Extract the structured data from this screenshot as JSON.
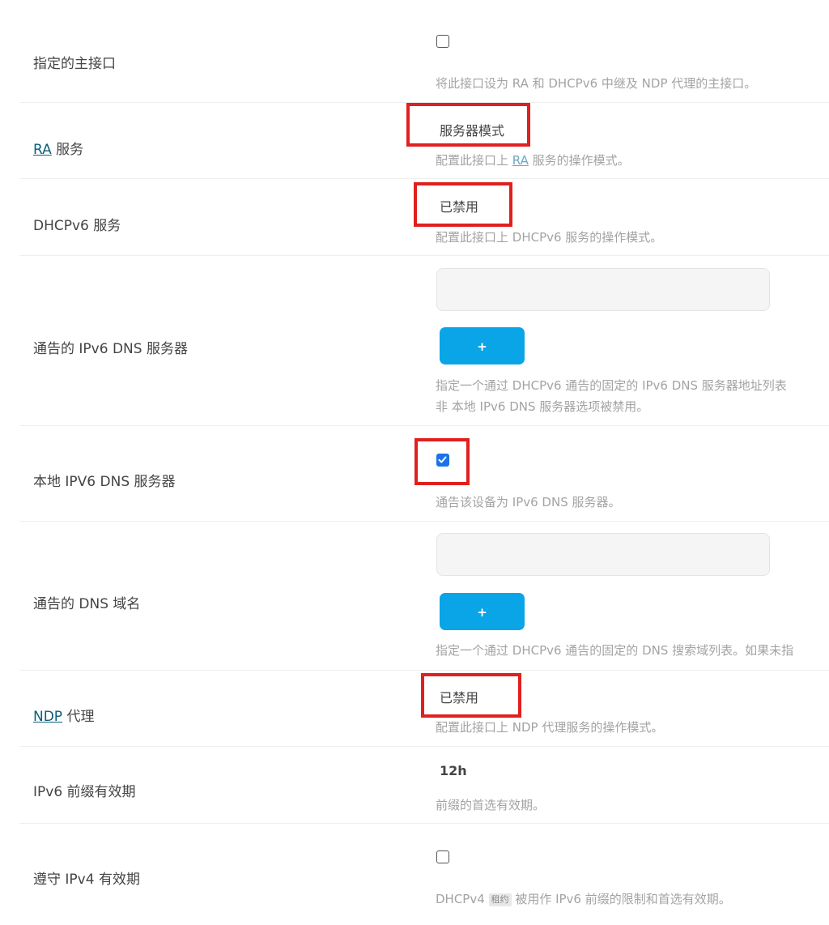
{
  "rows": {
    "master": {
      "label": "指定的主接口",
      "checked": false,
      "desc": "将此接口设为 RA 和 DHCPv6 中继及 NDP 代理的主接口。"
    },
    "ra": {
      "label_abbr": "RA",
      "label_rest": " 服务",
      "value": "服务器模式",
      "desc_pre": "配置此接口上 ",
      "desc_abbr": "RA",
      "desc_post": " 服务的操作模式。"
    },
    "dhcpv6": {
      "label": "DHCPv6 服务",
      "value": "已禁用",
      "desc": "配置此接口上 DHCPv6 服务的操作模式。"
    },
    "dns_servers": {
      "label": "通告的 IPv6 DNS 服务器",
      "input_value": "",
      "add_label": "+",
      "desc_line1": "指定一个通过 DHCPv6 通告的固定的 IPv6 DNS 服务器地址列表",
      "desc_line2": "非  本地 IPv6 DNS 服务器选项被禁用。"
    },
    "local_dns": {
      "label": "本地 IPV6 DNS 服务器",
      "checked": true,
      "desc": "通告该设备为 IPv6 DNS 服务器。"
    },
    "dns_domain": {
      "label": "通告的 DNS 域名",
      "input_value": "",
      "add_label": "+",
      "desc": "指定一个通过 DHCPv6 通告的固定的 DNS 搜索域列表。如果未指"
    },
    "ndp": {
      "label_abbr": "NDP",
      "label_rest": " 代理",
      "value": "已禁用",
      "desc": "配置此接口上 NDP 代理服务的操作模式。"
    },
    "prefix_lifetime": {
      "label": "IPv6 前缀有效期",
      "value": "12h",
      "desc": "前缀的首选有效期。"
    },
    "ipv4_lifetime": {
      "label": "遵守 IPv4 有效期",
      "checked": false,
      "desc_pre": "DHCPv4 ",
      "desc_tag": "租约",
      "desc_post": " 被用作 IPv6 前缀的限制和首选有效期。"
    }
  },
  "colors": {
    "highlight": "#e0201f",
    "add_button": "#0aa5e6",
    "checkbox_checked": "#1a73e8",
    "link": "#0b5f77"
  }
}
